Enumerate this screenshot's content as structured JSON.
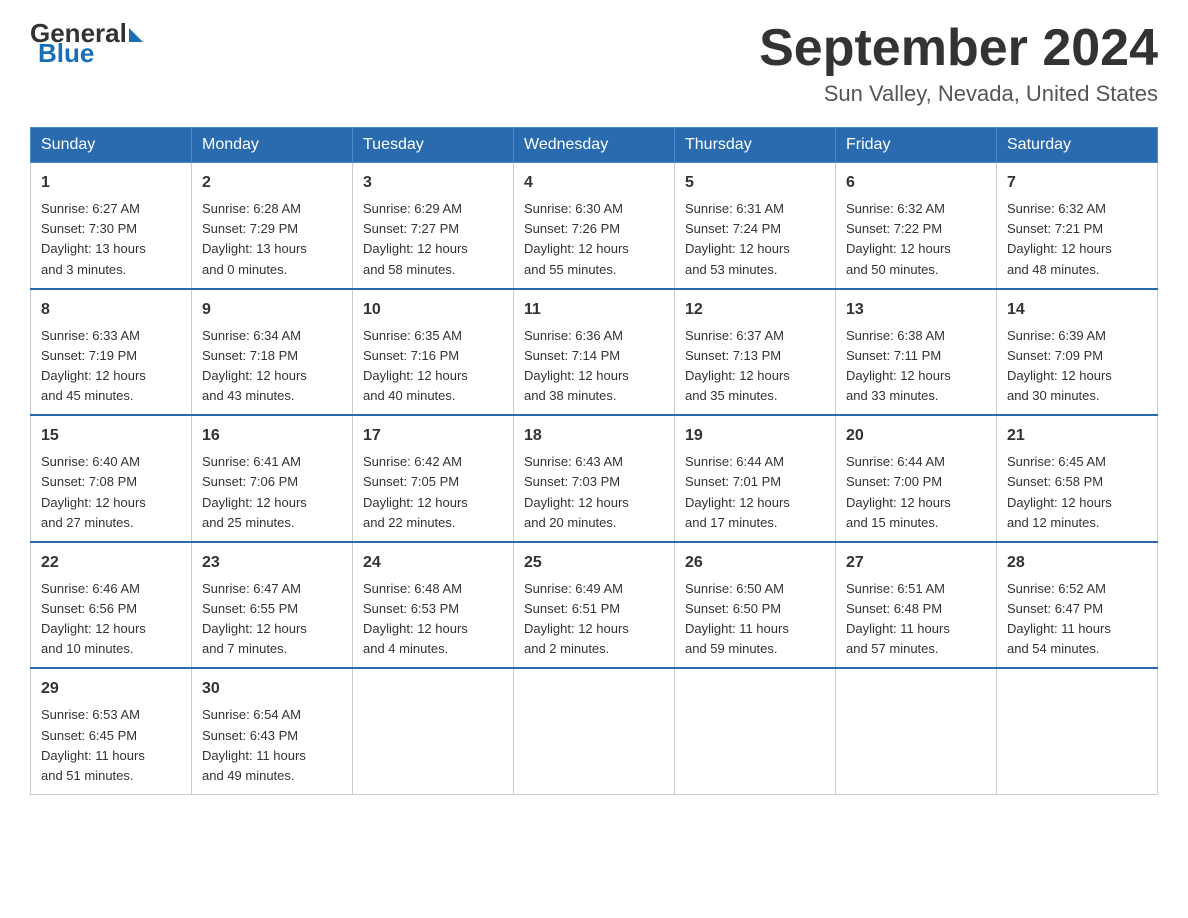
{
  "header": {
    "logo_general": "General",
    "logo_blue": "Blue",
    "month_title": "September 2024",
    "location": "Sun Valley, Nevada, United States"
  },
  "days_of_week": [
    "Sunday",
    "Monday",
    "Tuesday",
    "Wednesday",
    "Thursday",
    "Friday",
    "Saturday"
  ],
  "weeks": [
    [
      {
        "day": "1",
        "sunrise": "6:27 AM",
        "sunset": "7:30 PM",
        "daylight": "13 hours and 3 minutes."
      },
      {
        "day": "2",
        "sunrise": "6:28 AM",
        "sunset": "7:29 PM",
        "daylight": "13 hours and 0 minutes."
      },
      {
        "day": "3",
        "sunrise": "6:29 AM",
        "sunset": "7:27 PM",
        "daylight": "12 hours and 58 minutes."
      },
      {
        "day": "4",
        "sunrise": "6:30 AM",
        "sunset": "7:26 PM",
        "daylight": "12 hours and 55 minutes."
      },
      {
        "day": "5",
        "sunrise": "6:31 AM",
        "sunset": "7:24 PM",
        "daylight": "12 hours and 53 minutes."
      },
      {
        "day": "6",
        "sunrise": "6:32 AM",
        "sunset": "7:22 PM",
        "daylight": "12 hours and 50 minutes."
      },
      {
        "day": "7",
        "sunrise": "6:32 AM",
        "sunset": "7:21 PM",
        "daylight": "12 hours and 48 minutes."
      }
    ],
    [
      {
        "day": "8",
        "sunrise": "6:33 AM",
        "sunset": "7:19 PM",
        "daylight": "12 hours and 45 minutes."
      },
      {
        "day": "9",
        "sunrise": "6:34 AM",
        "sunset": "7:18 PM",
        "daylight": "12 hours and 43 minutes."
      },
      {
        "day": "10",
        "sunrise": "6:35 AM",
        "sunset": "7:16 PM",
        "daylight": "12 hours and 40 minutes."
      },
      {
        "day": "11",
        "sunrise": "6:36 AM",
        "sunset": "7:14 PM",
        "daylight": "12 hours and 38 minutes."
      },
      {
        "day": "12",
        "sunrise": "6:37 AM",
        "sunset": "7:13 PM",
        "daylight": "12 hours and 35 minutes."
      },
      {
        "day": "13",
        "sunrise": "6:38 AM",
        "sunset": "7:11 PM",
        "daylight": "12 hours and 33 minutes."
      },
      {
        "day": "14",
        "sunrise": "6:39 AM",
        "sunset": "7:09 PM",
        "daylight": "12 hours and 30 minutes."
      }
    ],
    [
      {
        "day": "15",
        "sunrise": "6:40 AM",
        "sunset": "7:08 PM",
        "daylight": "12 hours and 27 minutes."
      },
      {
        "day": "16",
        "sunrise": "6:41 AM",
        "sunset": "7:06 PM",
        "daylight": "12 hours and 25 minutes."
      },
      {
        "day": "17",
        "sunrise": "6:42 AM",
        "sunset": "7:05 PM",
        "daylight": "12 hours and 22 minutes."
      },
      {
        "day": "18",
        "sunrise": "6:43 AM",
        "sunset": "7:03 PM",
        "daylight": "12 hours and 20 minutes."
      },
      {
        "day": "19",
        "sunrise": "6:44 AM",
        "sunset": "7:01 PM",
        "daylight": "12 hours and 17 minutes."
      },
      {
        "day": "20",
        "sunrise": "6:44 AM",
        "sunset": "7:00 PM",
        "daylight": "12 hours and 15 minutes."
      },
      {
        "day": "21",
        "sunrise": "6:45 AM",
        "sunset": "6:58 PM",
        "daylight": "12 hours and 12 minutes."
      }
    ],
    [
      {
        "day": "22",
        "sunrise": "6:46 AM",
        "sunset": "6:56 PM",
        "daylight": "12 hours and 10 minutes."
      },
      {
        "day": "23",
        "sunrise": "6:47 AM",
        "sunset": "6:55 PM",
        "daylight": "12 hours and 7 minutes."
      },
      {
        "day": "24",
        "sunrise": "6:48 AM",
        "sunset": "6:53 PM",
        "daylight": "12 hours and 4 minutes."
      },
      {
        "day": "25",
        "sunrise": "6:49 AM",
        "sunset": "6:51 PM",
        "daylight": "12 hours and 2 minutes."
      },
      {
        "day": "26",
        "sunrise": "6:50 AM",
        "sunset": "6:50 PM",
        "daylight": "11 hours and 59 minutes."
      },
      {
        "day": "27",
        "sunrise": "6:51 AM",
        "sunset": "6:48 PM",
        "daylight": "11 hours and 57 minutes."
      },
      {
        "day": "28",
        "sunrise": "6:52 AM",
        "sunset": "6:47 PM",
        "daylight": "11 hours and 54 minutes."
      }
    ],
    [
      {
        "day": "29",
        "sunrise": "6:53 AM",
        "sunset": "6:45 PM",
        "daylight": "11 hours and 51 minutes."
      },
      {
        "day": "30",
        "sunrise": "6:54 AM",
        "sunset": "6:43 PM",
        "daylight": "11 hours and 49 minutes."
      },
      null,
      null,
      null,
      null,
      null
    ]
  ],
  "labels": {
    "sunrise": "Sunrise:",
    "sunset": "Sunset:",
    "daylight": "Daylight:"
  }
}
